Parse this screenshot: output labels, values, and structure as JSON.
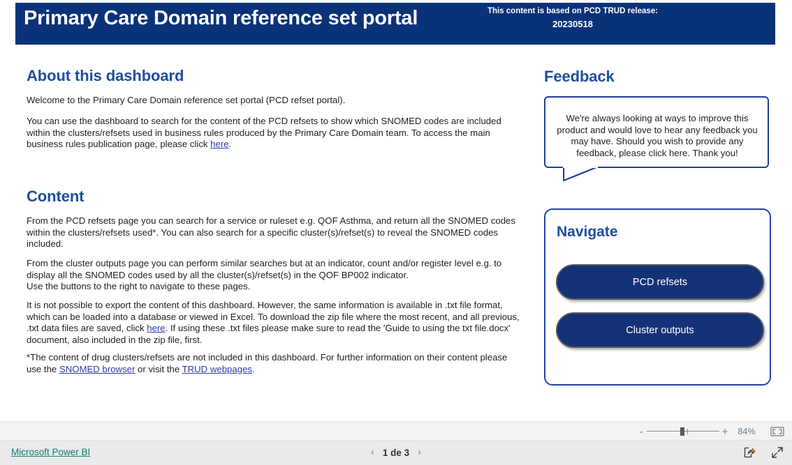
{
  "header": {
    "title": "Primary Care Domain reference set portal",
    "release_label": "This content is based on PCD TRUD release:",
    "release_value": "20230518",
    "background_color": "#0A3279"
  },
  "about": {
    "heading": "About this dashboard",
    "paragraph_1": "Welcome to the Primary Care Domain reference set portal (PCD refset portal).",
    "paragraph_2_before_link": "You can use the dashboard to search for the content of the PCD refsets to show which SNOMED codes are included within the clusters/refsets used in business rules produced by the Primary Care Domain team. To access the main business rules publication page, please click ",
    "paragraph_2_link": "here",
    "paragraph_2_after_link": "."
  },
  "content": {
    "heading": "Content",
    "paragraph_1": "From the PCD refsets page you can search for a service or ruleset e.g. QOF Asthma, and return all the SNOMED codes within the clusters/refsets used*. You can also search for a specific cluster(s)/refset(s) to reveal the SNOMED codes included.",
    "paragraph_2": "From the cluster outputs page you can perform similar searches but at an indicator, count and/or register level e.g. to display all the SNOMED codes used by all the cluster(s)/refset(s) in the QOF BP002 indicator.\nUse the buttons to the right to navigate to these pages.",
    "paragraph_3_before_link": "It is not possible to export the content of this dashboard. However, the same information is available in .txt file format, which can be loaded into a database or viewed in Excel. To download the zip file where the most recent, and all previous, .txt data files are saved, click ",
    "paragraph_3_link": "here",
    "paragraph_3_after_link": ". If using these .txt files please make sure to read the 'Guide to using the txt file.docx' document, also included in the zip file, first.",
    "paragraph_4_before_link_1": "*The content of drug clusters/refsets are not included in this dashboard. For further information on their content please use the ",
    "paragraph_4_link_1": "SNOMED browser",
    "paragraph_4_between_links": " or visit the ",
    "paragraph_4_link_2": "TRUD webpages",
    "paragraph_4_after_link_2": "."
  },
  "feedback": {
    "heading": "Feedback",
    "message": "We're always looking at ways to improve this product and would love to hear any feedback you may have. Should you wish to provide any feedback, please click here. Thank you!",
    "border_color": "#1F3F94"
  },
  "navigate": {
    "heading": "Navigate",
    "buttons": [
      {
        "label": "PCD refsets"
      },
      {
        "label": "Cluster outputs"
      }
    ],
    "button_fill_color": "#143278",
    "card_border_color": "#2442A8"
  },
  "toolbar": {
    "zoom_out_label": "-",
    "zoom_in_label": "+",
    "zoom_percent": "84%",
    "fit_to_page_icon": "fit-to-page-icon"
  },
  "statusbar": {
    "powerbi_link": "Microsoft Power BI",
    "prev_page_icon": "chevron-left-icon",
    "page_label": "1 de 3",
    "next_page_icon": "chevron-right-icon",
    "share_icon": "share-icon",
    "fullscreen_icon": "fullscreen-icon",
    "link_color": "#107C70"
  }
}
